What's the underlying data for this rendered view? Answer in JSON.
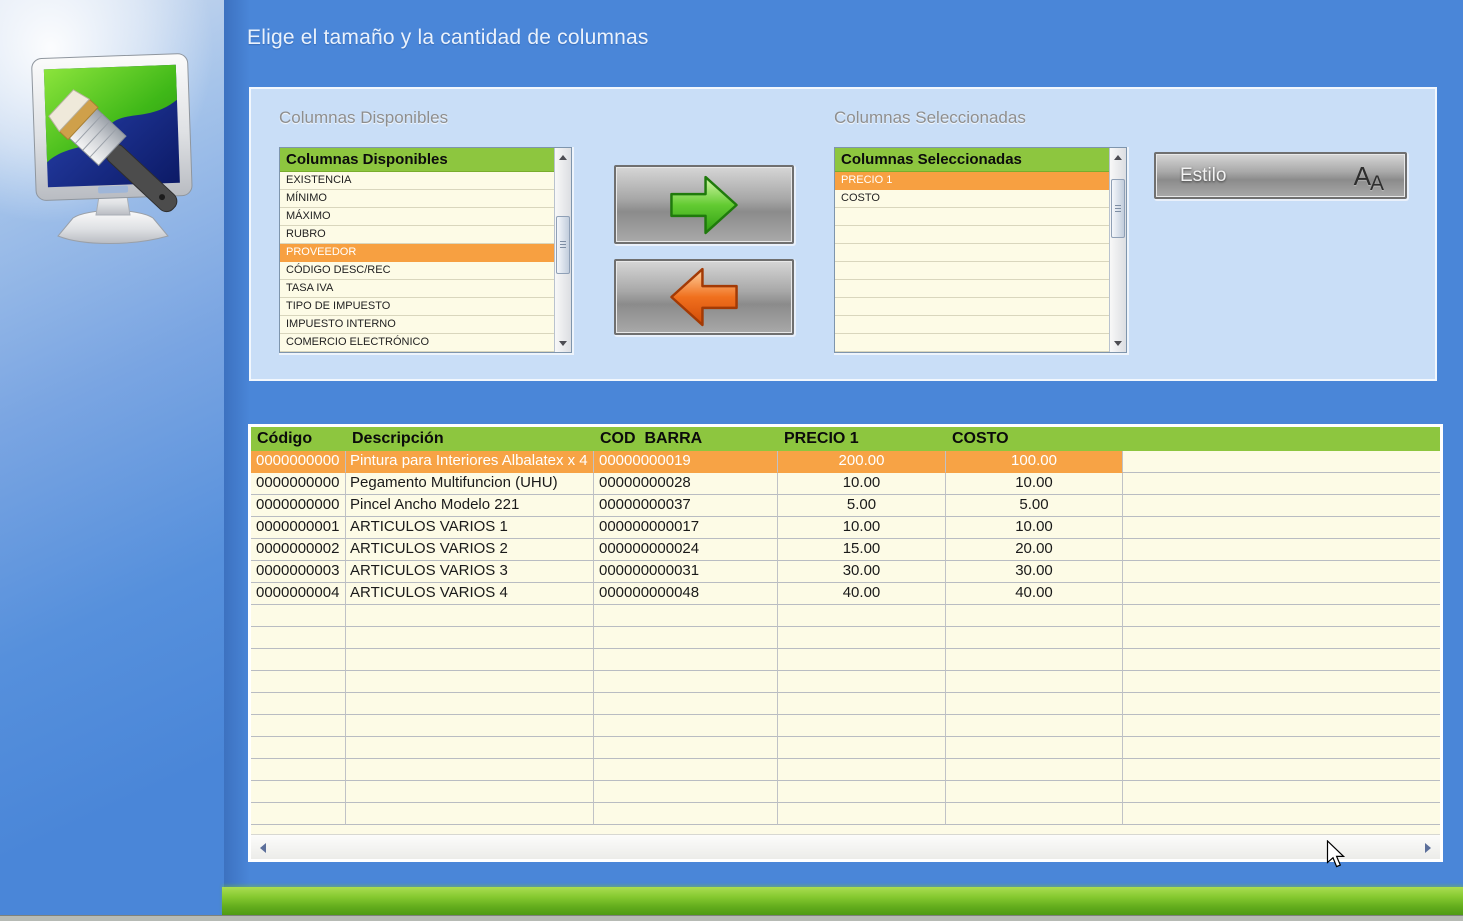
{
  "window": {
    "title": "Elige el tamaño y la cantidad de columnas"
  },
  "colors": {
    "background_blue": "#4a86d8",
    "panel_blue": "#c9def7",
    "header_green": "#8dc63f",
    "selection_orange": "#f7a345",
    "row_cream": "#fdfbe6"
  },
  "picker": {
    "available": {
      "label": "Columnas Disponibles",
      "list_header": "Columnas Disponibles",
      "items": [
        "EXISTENCIA",
        "MÍNIMO",
        "MÁXIMO",
        "RUBRO",
        "PROVEEDOR",
        "CÓDIGO DESC/REC",
        "TASA IVA",
        "TIPO DE IMPUESTO",
        "IMPUESTO INTERNO",
        "COMERCIO ELECTRÓNICO"
      ],
      "selected_item": "PROVEEDOR",
      "selected_index": 4,
      "empty_rows": 0
    },
    "selected": {
      "label": "Columnas Seleccionadas",
      "list_header": "Columnas Seleccionadas",
      "items": [
        "PRECIO 1",
        "COSTO"
      ],
      "selected_item": "PRECIO 1",
      "selected_index": 0,
      "empty_rows": 8
    },
    "move_right_icon": "green-right-arrow",
    "move_left_icon": "orange-left-arrow",
    "style_button": {
      "label": "Estilo",
      "icon_text_1": "A",
      "icon_text_2": "A"
    }
  },
  "grid": {
    "columns": [
      "Código",
      "Descripción",
      "COD  BARRA",
      "PRECIO 1",
      "COSTO",
      ""
    ],
    "rows": [
      [
        "0000000000",
        "Pintura para Interiores Albalatex x 4",
        "00000000019",
        "200.00",
        "100.00"
      ],
      [
        "0000000000",
        "Pegamento Multifuncion (UHU)",
        "00000000028",
        "10.00",
        "10.00"
      ],
      [
        "0000000000",
        "Pincel Ancho Modelo 221",
        "00000000037",
        "5.00",
        "5.00"
      ],
      [
        "0000000001",
        "ARTICULOS VARIOS 1",
        "000000000017",
        "10.00",
        "10.00"
      ],
      [
        "0000000002",
        "ARTICULOS VARIOS 2",
        "000000000024",
        "15.00",
        "20.00"
      ],
      [
        "0000000003",
        "ARTICULOS VARIOS 3",
        "000000000031",
        "30.00",
        "30.00"
      ],
      [
        "0000000004",
        "ARTICULOS VARIOS 4",
        "000000000048",
        "40.00",
        "40.00"
      ]
    ],
    "selected_row_index": 0,
    "empty_row_count": 10
  }
}
